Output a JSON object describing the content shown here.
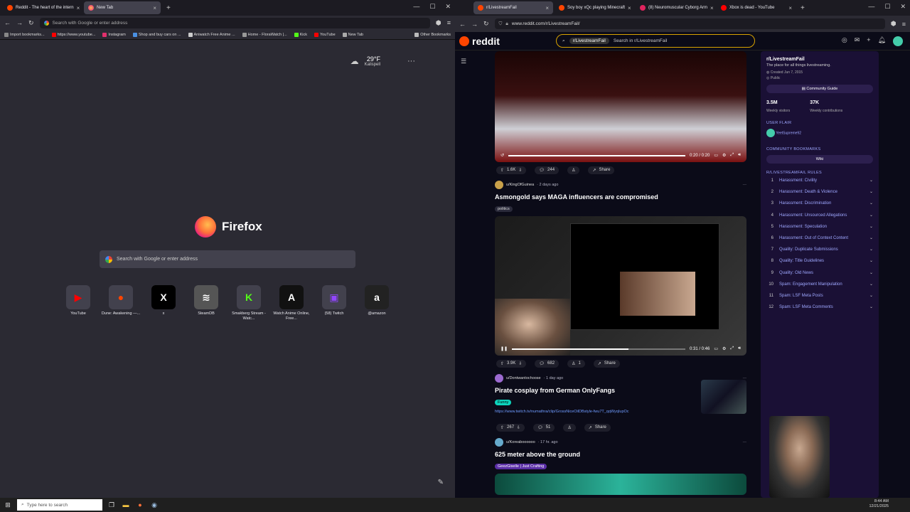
{
  "left_browser": {
    "tabs": [
      {
        "label": "Reddit - The heart of the intern"
      },
      {
        "label": "New Tab"
      }
    ],
    "urlbar_placeholder": "Search with Google or enter address",
    "bookmarks": [
      "Import bookmarks...",
      "https://www.youtube...",
      "Instagram",
      "Shop and buy cars on ...",
      "Aniwatch Free Anime ...",
      "Home - FloraWatch |...",
      "Kick",
      "YouTube",
      "New Tab",
      "Other Bookmarks"
    ],
    "weather": {
      "temp": "29°F",
      "city": "Kalispell"
    },
    "brand": "Firefox",
    "search_placeholder": "Search with Google or enter address",
    "shortcuts": [
      {
        "label": "YouTube",
        "glyph": "▶",
        "color": "#ff0000"
      },
      {
        "label": "Dune: Awakening —...",
        "glyph": "●",
        "color": "#ff4500"
      },
      {
        "label": "x",
        "glyph": "X",
        "color": "#000000"
      },
      {
        "label": "SteamDB",
        "glyph": "≋",
        "color": "#555555"
      },
      {
        "label": "Smakberg Stream - Watc...",
        "glyph": "K",
        "color": "#53fc18"
      },
      {
        "label": "Watch Anime Online, Free...",
        "glyph": "A",
        "color": "#111111"
      },
      {
        "label": "(58) Twitch",
        "glyph": "▣",
        "color": "#9146ff"
      },
      {
        "label": "@amazon",
        "glyph": "a",
        "color": "#222222"
      }
    ]
  },
  "right_browser": {
    "tabs": [
      {
        "label": "r/LivestreamFail",
        "color": "#ff4500"
      },
      {
        "label": "Soy boy xQc playing Minecraft",
        "color": "#ff4500"
      },
      {
        "label": "(8) Neuromuscular Cyborg Arm",
        "color": "#e0245e"
      },
      {
        "label": "Xbox is dead - YouTube",
        "color": "#ff0000"
      }
    ],
    "url": "www.reddit.com/r/LivestreamFail/",
    "reddit": {
      "logo": "reddit",
      "search_chip": "r/LivestreamFail",
      "search_placeholder": "Search in r/LivestreamFail",
      "video1": {
        "time": "0:20 / 0:20",
        "progress": 1.0,
        "upvotes": "1.6K",
        "comments": "244",
        "share": "Share"
      },
      "post2": {
        "user": "u/KingOfGuinea",
        "age": "· 2 days ago",
        "title": "Asmongold says MAGA influencers are compromised",
        "flair": "politics",
        "time": "0:31 / 0:46",
        "progress": 0.674,
        "upvotes": "3.9K",
        "comments": "682",
        "award": "1",
        "share": "Share"
      },
      "post3": {
        "user": "u/Dontwantochoose",
        "age": "· 1 day ago",
        "title": "Pirate cosplay from German OnlyFangs",
        "flair": "Funny",
        "link": "https://www.twitch.tv/numathra/clip/GrossNiceOilDBstyle-fwu7T_qqWyqIupOc",
        "upvotes": "267",
        "comments": "51",
        "share": "Share"
      },
      "post4": {
        "user": "u/Koreaboooooo",
        "age": "· 17 hr. ago",
        "title": "625 meter above the ground",
        "flair": "GeezGiselle | Just Crafting"
      },
      "sidebar": {
        "name": "r/LivestreamFail",
        "desc": "The place for all things livestreaming.",
        "created": "Created Jun 7, 2015",
        "visibility": "Public",
        "guide": "Community Guide",
        "visitors": "3.5M",
        "visitors_label": "Weekly visitors",
        "contrib": "37K",
        "contrib_label": "Weekly contributions",
        "flair_h": "USER FLAIR",
        "flair_user": "YeetSupreme92",
        "bookmarks_h": "COMMUNITY BOOKMARKS",
        "wiki": "Wiki",
        "rules_h": "R/LIVESTREAMFAIL RULES",
        "rules": [
          {
            "n": "1",
            "t": "Harassment: Civility"
          },
          {
            "n": "2",
            "t": "Harassment: Death & Violence"
          },
          {
            "n": "3",
            "t": "Harassment: Discrimination"
          },
          {
            "n": "4",
            "t": "Harassment: Unsourced Allegations"
          },
          {
            "n": "5",
            "t": "Harassment: Speculation"
          },
          {
            "n": "6",
            "t": "Harassment: Out of Context Content"
          },
          {
            "n": "7",
            "t": "Quality: Duplicate Submissions"
          },
          {
            "n": "8",
            "t": "Quality: Title Guidelines"
          },
          {
            "n": "9",
            "t": "Quality: Old News"
          },
          {
            "n": "10",
            "t": "Spam: Engagement Manipulation"
          },
          {
            "n": "11",
            "t": "Spam: LSF Meta Posts"
          },
          {
            "n": "12",
            "t": "Spam: LSF Meta Comments"
          }
        ]
      }
    }
  },
  "taskbar": {
    "search": "Type here to search",
    "time": "8:44 AM",
    "date": "12/21/2025"
  }
}
